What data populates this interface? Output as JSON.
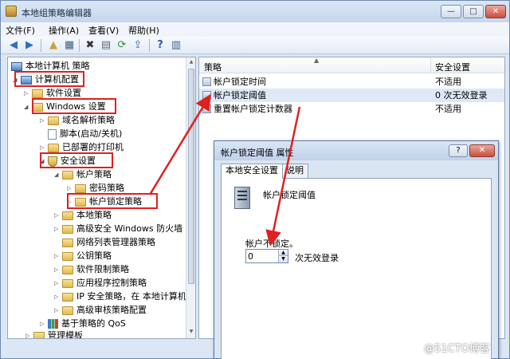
{
  "window": {
    "title": "本地组策略编辑器",
    "minimize": "—",
    "maximize": "□",
    "close": "✕"
  },
  "menu": [
    "文件(F)",
    "操作(A)",
    "查看(V)",
    "帮助(H)"
  ],
  "toolbar_icons": [
    "back-icon",
    "forward-icon",
    "up-folder-icon",
    "show-hide-tree-icon",
    "delete-icon",
    "properties-icon",
    "refresh-icon",
    "export-icon",
    "help-icon",
    "view-icon"
  ],
  "tree": {
    "root": "本地计算机 策略",
    "computer_config": "计算机配置",
    "software_settings": "软件设置",
    "windows_settings": "Windows 设置",
    "dns_policy": "域名解析策略",
    "scripts": "脚本(启动/关机)",
    "deployed_printers": "已部署的打印机",
    "security_settings": "安全设置",
    "account_policies": "帐户策略",
    "password_policy": "密码策略",
    "lockout_policy": "帐户锁定策略",
    "local_policies": "本地策略",
    "firewall": "高级安全 Windows 防火墙",
    "network_list": "网络列表管理器策略",
    "public_key": "公钥策略",
    "software_restriction": "软件限制策略",
    "app_control": "应用程序控制策略",
    "ipsec": "IP 安全策略，在 本地计算机",
    "audit": "高级审核策略配置",
    "qos": "基于策略的 QoS",
    "admin_templates": "管理模板"
  },
  "list": {
    "col_policy": "策略",
    "col_setting": "安全设置",
    "rows": [
      {
        "policy": "帐户锁定时间",
        "value": "不适用"
      },
      {
        "policy": "帐户锁定阈值",
        "value": "0 次无效登录"
      },
      {
        "policy": "重置帐户锁定计数器",
        "value": "不适用"
      }
    ]
  },
  "dialog": {
    "title": "帐户锁定阈值 属性",
    "help": "?",
    "close": "✕",
    "tab_local": "本地安全设置",
    "tab_explain": "说明",
    "policy_name": "帐户锁定阈值",
    "label": "帐户不锁定。",
    "value": "0",
    "unit": "次无效登录"
  },
  "watermark": "@51CTO博客"
}
